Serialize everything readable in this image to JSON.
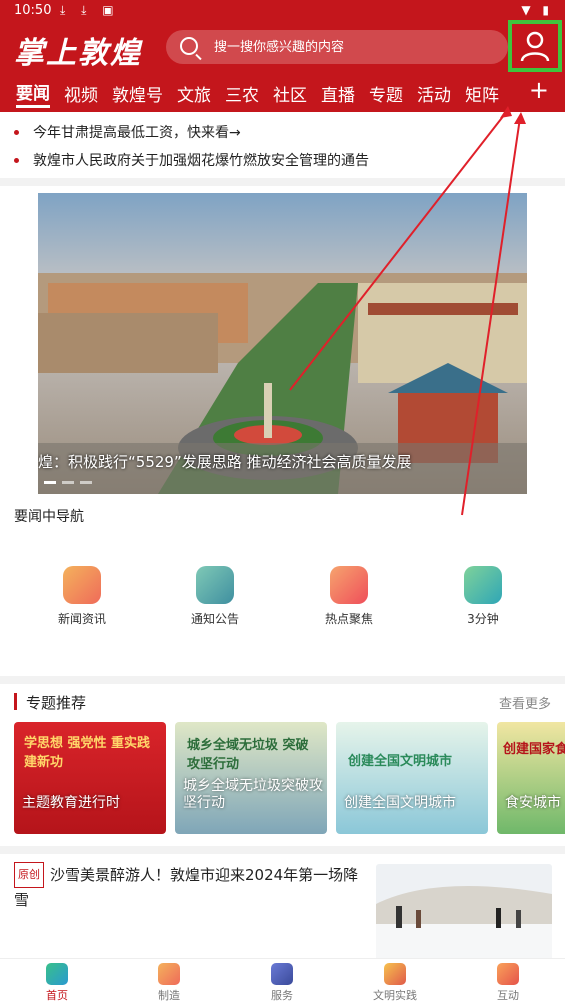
{
  "status": {
    "time": "10:50",
    "left_icons": "⤓ ⤓ ▣",
    "right_icons": "▼ ▮"
  },
  "header": {
    "logo": "掌上敦煌",
    "search_placeholder": "搜一搜你感兴趣的内容",
    "user_icon": "user-icon"
  },
  "tabs": [
    {
      "label": "要闻",
      "active": true
    },
    {
      "label": "视频"
    },
    {
      "label": "敦煌号"
    },
    {
      "label": "文旅"
    },
    {
      "label": "三农"
    },
    {
      "label": "社区"
    },
    {
      "label": "直播"
    },
    {
      "label": "专题"
    },
    {
      "label": "活动"
    },
    {
      "label": "矩阵"
    }
  ],
  "tab_more": "+",
  "ticker": [
    "今年甘肃提高最低工资，快来看→",
    "敦煌市人民政府关于加强烟花爆竹燃放安全管理的通告"
  ],
  "banner": {
    "caption": "煌：积极践行“5529”发展思路 推动经济社会高质量发展"
  },
  "nav": {
    "title": "要闻中导航",
    "items": [
      {
        "label": "新闻资讯",
        "color": "#f08a3c"
      },
      {
        "label": "通知公告",
        "color": "#3fa9a0"
      },
      {
        "label": "热点聚焦",
        "color": "#ef6b5a"
      },
      {
        "label": "3分钟",
        "color": "#5cbf7a"
      }
    ]
  },
  "topics": {
    "title": "专题推荐",
    "more": "查看更多",
    "cards": [
      {
        "label": "主题教育进行时",
        "inner": "学思想 强党性 重实践 建新功"
      },
      {
        "label": "城乡全域无垃圾突破攻坚行动",
        "inner": "城乡全域无垃圾 突破攻坚行动"
      },
      {
        "label": "创建全国文明城市",
        "inner": "创建全国文明城市"
      },
      {
        "label": "食安城市",
        "inner": "创建国家食"
      }
    ]
  },
  "article": {
    "badge": "原创",
    "title": "沙雪美景醉游人！敦煌市迎来2024年第一场降雪"
  },
  "bottom_nav": [
    {
      "label": "首页",
      "active": true
    },
    {
      "label": "制造"
    },
    {
      "label": "服务"
    },
    {
      "label": "文明实践"
    },
    {
      "label": "互动"
    }
  ]
}
